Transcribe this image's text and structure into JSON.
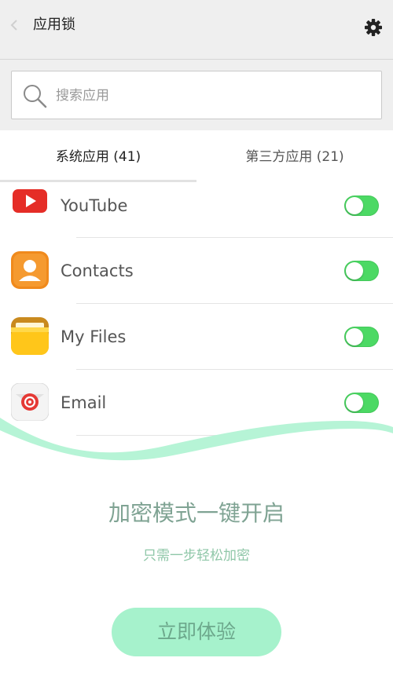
{
  "header": {
    "title": "应用锁",
    "back_icon": "back-arrow-icon",
    "settings_icon": "gear-icon"
  },
  "search": {
    "placeholder": "搜索应用"
  },
  "tabs": [
    {
      "label": "系统应用 (41)",
      "active": true
    },
    {
      "label": "第三方应用 (21)",
      "active": false
    }
  ],
  "apps": [
    {
      "name": "YouTube",
      "icon": "youtube-icon",
      "locked": true
    },
    {
      "name": "Contacts",
      "icon": "contacts-icon",
      "locked": true
    },
    {
      "name": "My Files",
      "icon": "folder-icon",
      "locked": true
    },
    {
      "name": "Email",
      "icon": "email-icon",
      "locked": true
    }
  ],
  "promo": {
    "title": "加密模式一键开启",
    "subtitle": "只需一步轻松加密",
    "button_label": "立即体验"
  },
  "colors": {
    "toggle_on": "#4cd964",
    "accent_mint": "#a6f2cc",
    "wave": "#aef3d2"
  }
}
